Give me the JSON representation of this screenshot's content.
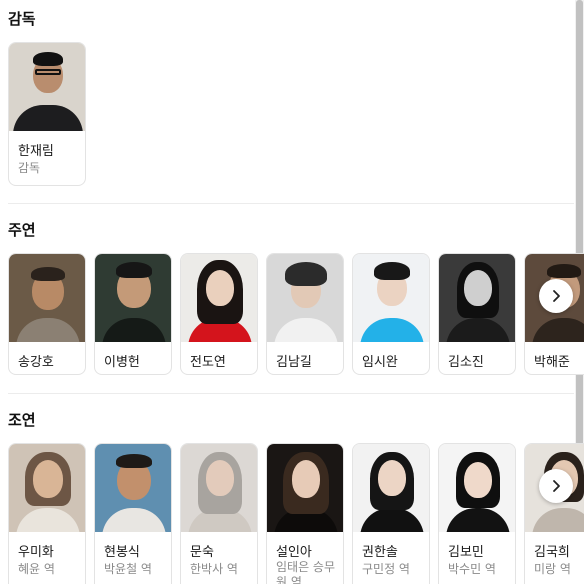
{
  "director_section": {
    "title": "감독",
    "people": [
      {
        "name": "한재림",
        "role": "감독"
      }
    ]
  },
  "lead_section": {
    "title": "주연",
    "people": [
      {
        "name": "송강호"
      },
      {
        "name": "이병헌"
      },
      {
        "name": "전도연"
      },
      {
        "name": "김남길"
      },
      {
        "name": "임시완"
      },
      {
        "name": "김소진"
      },
      {
        "name": "박해준"
      }
    ]
  },
  "support_section": {
    "title": "조연",
    "people": [
      {
        "name": "우미화",
        "role": "혜윤 역"
      },
      {
        "name": "현봉식",
        "role": "박윤철 역"
      },
      {
        "name": "문숙",
        "role": "한박사 역"
      },
      {
        "name": "설인아",
        "role": "임태은 승무원 역"
      },
      {
        "name": "권한솔",
        "role": "구민정 역"
      },
      {
        "name": "김보민",
        "role": "박수민 역"
      },
      {
        "name": "김국희",
        "role": "미랑 역"
      }
    ]
  },
  "icons": {
    "next": "chevron-right-icon"
  }
}
